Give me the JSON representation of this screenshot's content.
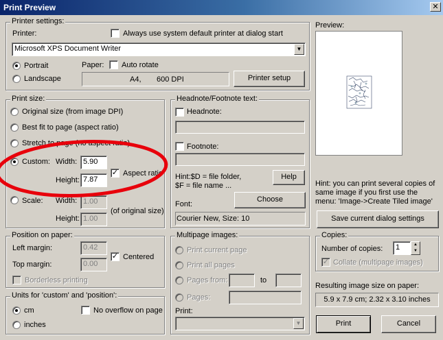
{
  "window": {
    "title": "Print Preview",
    "close_symbol": "✕"
  },
  "printer_settings": {
    "group_label": "Printer settings:",
    "printer_label": "Printer:",
    "always_default_label": "Always use system default printer at dialog start",
    "always_default_checked": false,
    "printer_value": "Microsoft XPS Document Writer",
    "portrait_label": "Portrait",
    "landscape_label": "Landscape",
    "orientation": "portrait",
    "paper_label": "Paper:",
    "auto_rotate_label": "Auto rotate",
    "auto_rotate_checked": false,
    "paper_size": "A4,",
    "dpi": "600 DPI",
    "printer_setup_label": "Printer setup"
  },
  "print_size": {
    "group_label": "Print size:",
    "original_label": "Original size (from image DPI)",
    "best_fit_label": "Best fit to page (aspect ratio)",
    "stretch_label": "Stretch to page (no aspect ratio)",
    "custom_label": "Custom:",
    "width_label": "Width:",
    "height_label": "Height:",
    "custom_width": "5.90",
    "custom_height": "7.87",
    "aspect_ratio_label": "Aspect ratio",
    "aspect_ratio_checked": true,
    "scale_label": "Scale:",
    "scale_width": "1.00",
    "scale_height": "1.00",
    "of_original_label": "(of original size)",
    "selected": "custom"
  },
  "headnote": {
    "group_label": "Headnote/Footnote text:",
    "headnote_label": "Headnote:",
    "footnote_label": "Footnote:",
    "hint_line1": "Hint:$D = file folder,",
    "hint_line2": "$F = file name ...",
    "help_label": "Help",
    "font_label": "Font:",
    "choose_label": "Choose",
    "font_value": "Courier New, Size: 10"
  },
  "preview": {
    "label": "Preview:",
    "hint": "Hint: you can print several copies of same image if you first use the menu: 'Image->Create Tiled image'",
    "save_label": "Save current dialog settings"
  },
  "position": {
    "group_label": "Position on paper:",
    "left_margin_label": "Left margin:",
    "left_margin": "0.42",
    "top_margin_label": "Top margin:",
    "top_margin": "0.00",
    "centered_label": "Centered",
    "centered_checked": true,
    "borderless_label": "Borderless printing"
  },
  "multipage": {
    "group_label": "Multipage images:",
    "current_label": "Print current page",
    "all_label": "Print all pages",
    "from_label": "Pages from:",
    "to_label": "to",
    "pages_label": "Pages:",
    "print_label": "Print:"
  },
  "copies": {
    "group_label": "Copies:",
    "number_label": "Number of copies:",
    "number_value": "1",
    "collate_label": "Collate (multipage images)"
  },
  "units": {
    "group_label": "Units for 'custom' and 'position':",
    "cm_label": "cm",
    "inches_label": "inches",
    "no_overflow_label": "No overflow on page",
    "selected": "cm"
  },
  "result": {
    "label": "Resulting image size on paper:",
    "value": "5.9 x 7.9 cm; 2.32 x 3.10 inches"
  },
  "buttons": {
    "print_label": "Print",
    "cancel_label": "Cancel"
  },
  "annotation": {
    "color": "#e8000b"
  }
}
